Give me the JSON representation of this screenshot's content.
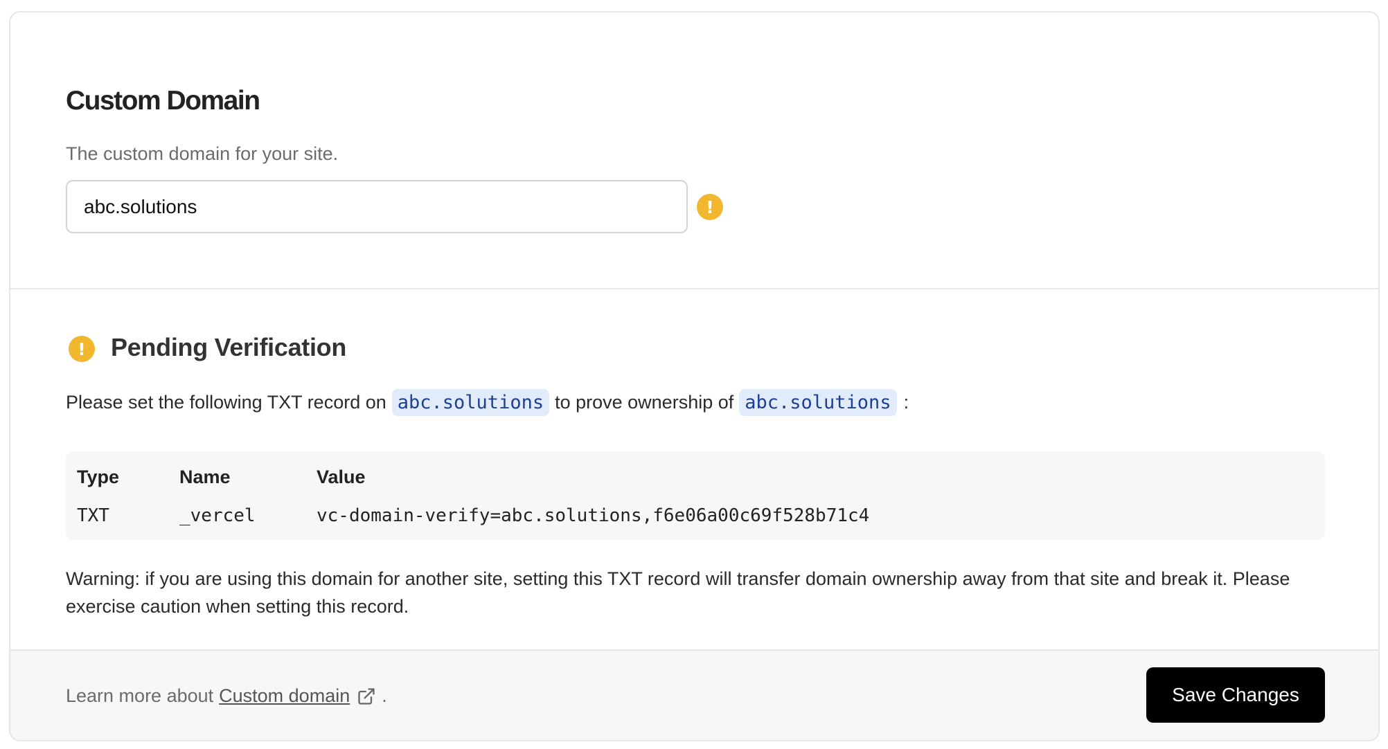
{
  "custom_domain": {
    "title": "Custom Domain",
    "subtitle": "The custom domain for your site.",
    "input_value": "abc.solutions",
    "status_icon": "warning-exclamation-icon",
    "status_color": "#f0b72f"
  },
  "verification": {
    "title": "Pending Verification",
    "instruction_prefix": "Please set the following TXT record on",
    "domain_1": "abc.solutions",
    "instruction_middle": "to prove ownership of",
    "domain_2": "abc.solutions",
    "instruction_suffix": ":",
    "record": {
      "headers": [
        "Type",
        "Name",
        "Value"
      ],
      "row": [
        "TXT",
        "_vercel",
        "vc-domain-verify=abc.solutions,f6e06a00c69f528b71c4"
      ]
    },
    "warning": "Warning: if you are using this domain for another site, setting this TXT record will transfer domain ownership away from that site and break it. Please exercise caution when setting this record."
  },
  "footer": {
    "learn_prefix": "Learn more about",
    "learn_link": "Custom domain",
    "learn_suffix": ".",
    "save_label": "Save Changes"
  }
}
